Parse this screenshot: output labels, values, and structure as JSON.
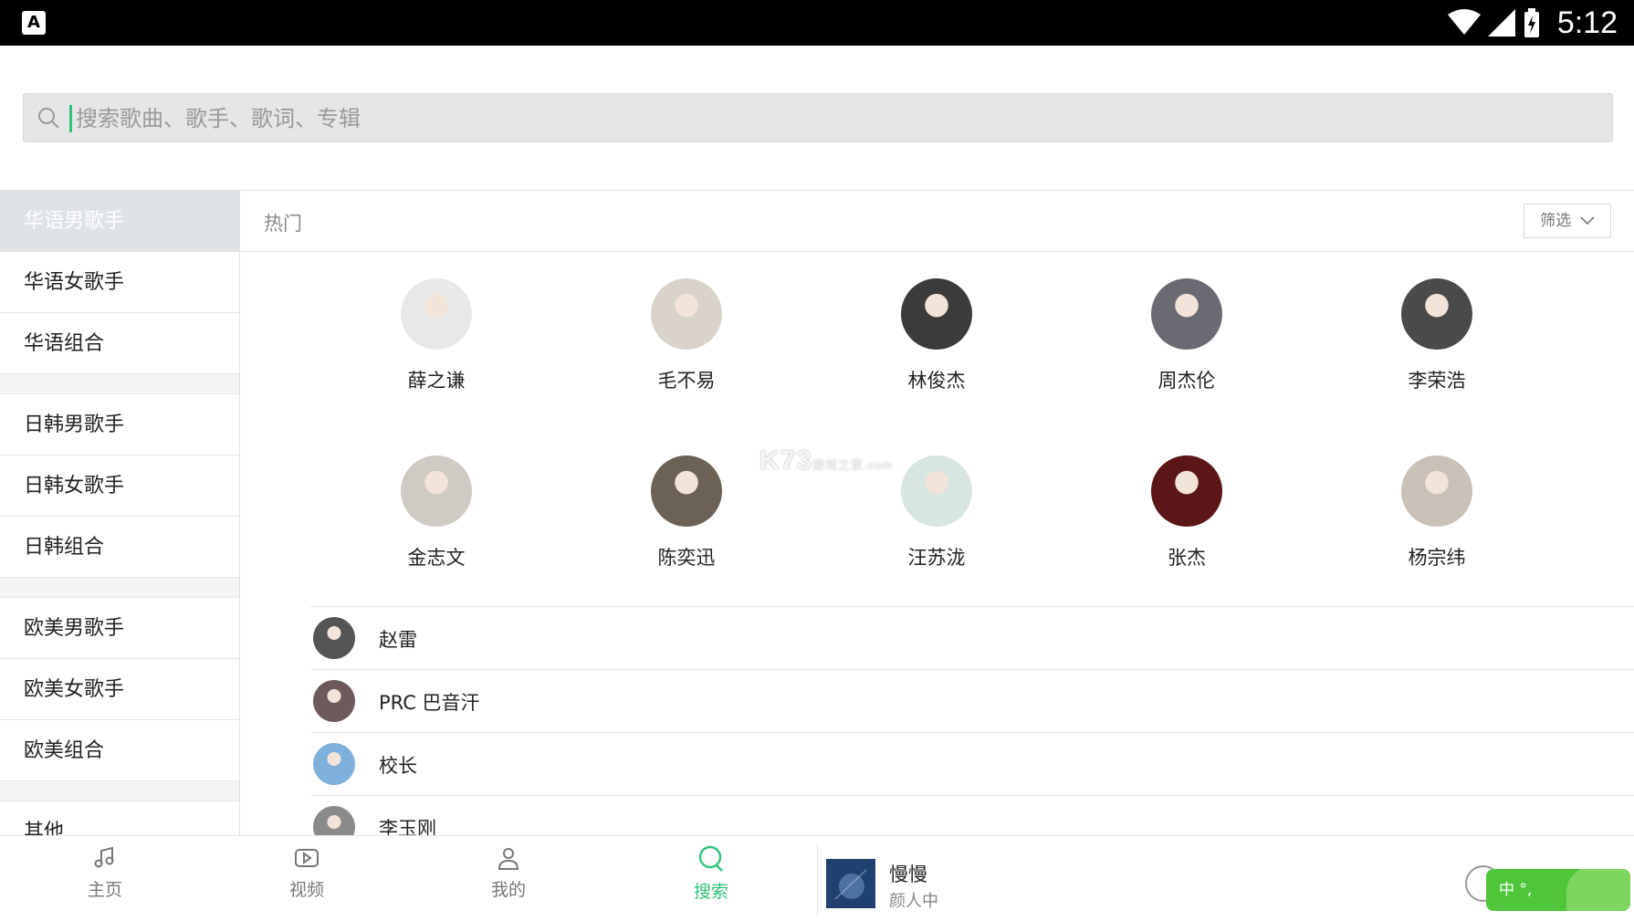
{
  "status_bar": {
    "time": "5:12",
    "notification_icon": "A",
    "icons": [
      "wifi-icon",
      "signal-icon",
      "battery-charging-icon"
    ]
  },
  "search": {
    "placeholder": "搜索歌曲、歌手、歌词、专辑",
    "value": ""
  },
  "sidebar": {
    "items": [
      {
        "label": "华语男歌手",
        "active": true
      },
      {
        "label": "华语女歌手"
      },
      {
        "label": "华语组合"
      },
      {
        "label": "日韩男歌手"
      },
      {
        "label": "日韩女歌手"
      },
      {
        "label": "日韩组合"
      },
      {
        "label": "欧美男歌手"
      },
      {
        "label": "欧美女歌手"
      },
      {
        "label": "欧美组合"
      },
      {
        "label": "其他"
      }
    ]
  },
  "main": {
    "section_title": "热门",
    "filter_label": "筛选",
    "hot_artists": [
      {
        "name": "薛之谦",
        "tone": "#e8e8e8"
      },
      {
        "name": "毛不易",
        "tone": "#d9d3cb"
      },
      {
        "name": "林俊杰",
        "tone": "#3b3b3b"
      },
      {
        "name": "周杰伦",
        "tone": "#6a6a72"
      },
      {
        "name": "李荣浩",
        "tone": "#4a4a4a"
      },
      {
        "name": "金志文",
        "tone": "#cfcac4"
      },
      {
        "name": "陈奕迅",
        "tone": "#6b6154"
      },
      {
        "name": "汪苏泷",
        "tone": "#d7e6e2"
      },
      {
        "name": "张杰",
        "tone": "#5b1618"
      },
      {
        "name": "杨宗纬",
        "tone": "#c9c1b7"
      }
    ],
    "artist_list": [
      {
        "name": "赵雷",
        "tone": "#555555"
      },
      {
        "name": "PRC 巴音汗",
        "tone": "#6e5a5a"
      },
      {
        "name": "校长",
        "tone": "#7fb0dc"
      },
      {
        "name": "李玉刚",
        "tone": "#8a8a8a"
      }
    ]
  },
  "watermark": {
    "main": "K73",
    "sub": "游戏之家",
    "domain": ".com"
  },
  "bottom_nav": {
    "tabs": [
      {
        "label": "主页",
        "icon": "music-note-icon"
      },
      {
        "label": "视频",
        "icon": "video-play-icon"
      },
      {
        "label": "我的",
        "icon": "user-icon"
      },
      {
        "label": "搜索",
        "icon": "search-icon",
        "active": true
      }
    ],
    "accent_color": "#31c27c"
  },
  "now_playing": {
    "title": "慢慢",
    "artist": "颜人中"
  },
  "ime_badge": {
    "text": "中 °,"
  }
}
